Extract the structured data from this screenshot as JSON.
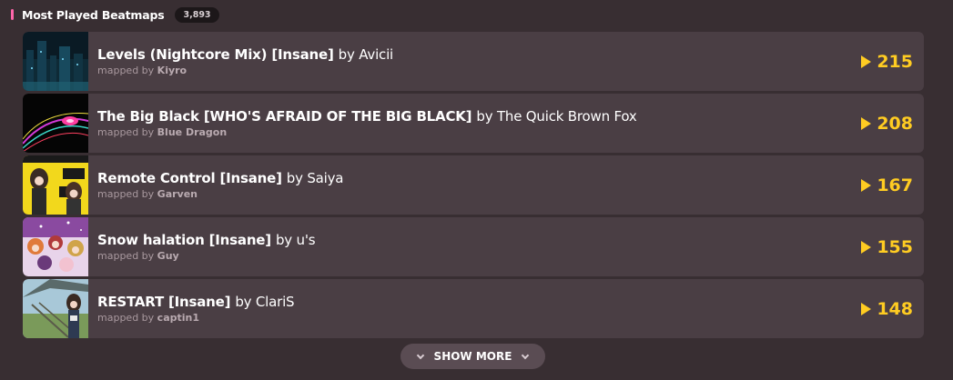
{
  "section": {
    "title": "Most Played Beatmaps",
    "count": "3,893"
  },
  "beatmaps": [
    {
      "title": "Levels (Nightcore Mix) [Insane]",
      "artist": "by Avicii",
      "mapped_by_label": "mapped by",
      "mapper": "Kiyro",
      "plays": "215"
    },
    {
      "title": "The Big Black [WHO'S AFRAID OF THE BIG BLACK]",
      "artist": "by The Quick Brown Fox",
      "mapped_by_label": "mapped by",
      "mapper": "Blue Dragon",
      "plays": "208"
    },
    {
      "title": "Remote Control [Insane]",
      "artist": "by Saiya",
      "mapped_by_label": "mapped by",
      "mapper": "Garven",
      "plays": "167"
    },
    {
      "title": "Snow halation [Insane]",
      "artist": "by u's",
      "mapped_by_label": "mapped by",
      "mapper": "Guy",
      "plays": "155"
    },
    {
      "title": "RESTART [Insane]",
      "artist": "by ClariS",
      "mapped_by_label": "mapped by",
      "mapper": "captin1",
      "plays": "148"
    }
  ],
  "show_more_label": "SHOW MORE",
  "colors": {
    "accent": "#ff66aa",
    "plays": "#ffcc22",
    "background": "#382e32",
    "row": "#4a3e44"
  },
  "icons": {
    "play": "play-icon",
    "chevron": "chevron-down-icon"
  }
}
